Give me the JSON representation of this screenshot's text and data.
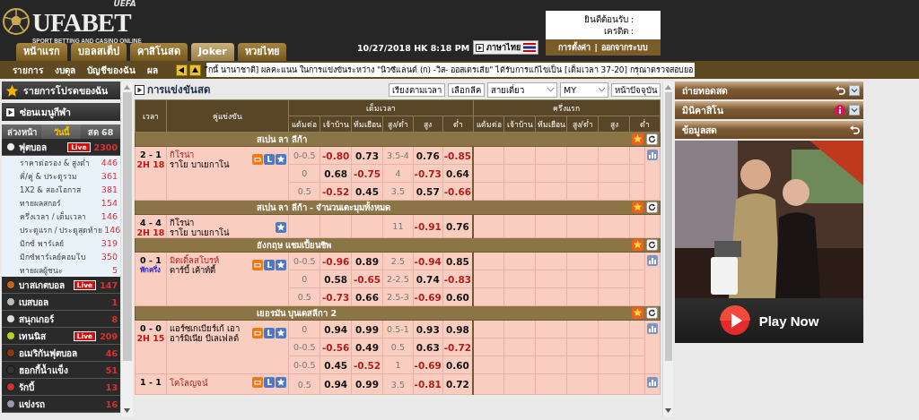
{
  "header": {
    "logo": {
      "badge": "UEFA",
      "text": "UFABET",
      "tagline": "SPORT BETTING AND CASINO ONLINE"
    },
    "tabs": [
      {
        "label": "หน้าแรก",
        "selected": false
      },
      {
        "label": "บอลสเต็ป",
        "selected": false
      },
      {
        "label": "คาสิโนสด",
        "selected": false
      },
      {
        "label": "Joker",
        "selected": true
      },
      {
        "label": "หวยไทย",
        "selected": false
      }
    ],
    "datetime": "10/27/2018 HK 8:18 PM",
    "language": "ภาษาไทย",
    "account": {
      "welcome": "ยินดีต้อนรับ :",
      "credit": "เครดิต :",
      "links": [
        "การตั้งค่า",
        "ออกจากระบบ"
      ],
      "separator": "|"
    }
  },
  "nav": {
    "items": [
      "รายการ",
      "งบดุล",
      "บัญชีของฉัน",
      "ผล"
    ],
    "ticker": "ีกนี้ นานาชาติ] ผลคะแนน ในการแข่งขันระหว่าง \"นิวซีแลนด์ (ก) -วิส- ออสเตรเลีย\" ได้รับการแก้ไขเป็น [เต็มเวลา 37-20] กรุณาตรวจสอบยอ"
  },
  "sidebar": {
    "favorites": "รายการโปรดของฉัน",
    "hide_menu": "ซ่อนเมนูกีฬา",
    "tabs": [
      {
        "label": "ล่วงหน้า",
        "selected": false
      },
      {
        "label": "วันนี้",
        "selected": true
      },
      {
        "label": "สด 68",
        "selected": false
      }
    ],
    "sports": [
      {
        "name": "ฟุตบอล",
        "badge": "Live",
        "count": "2300",
        "children": [
          {
            "name": "ราคาต่อรอง & สูงต่ำ",
            "count": "446"
          },
          {
            "name": "คี่/คู่ & ประตูรวม",
            "count": "361"
          },
          {
            "name": "1X2 & สองโอกาส",
            "count": "381"
          },
          {
            "name": "ทายผลสกอร์",
            "count": "154"
          },
          {
            "name": "ครึ่งเวลา / เต็มเวลา",
            "count": "146"
          },
          {
            "name": "ประตูแรก / ประตูสุดท้าย",
            "count": "146"
          },
          {
            "name": "มิกซ์ พาร์เลย์",
            "count": "319"
          },
          {
            "name": "มิกซ์พาร์เลย์คอมโบ",
            "count": "350"
          },
          {
            "name": "ทายผลผู้ชนะ",
            "count": "5"
          }
        ]
      },
      {
        "name": "บาสเกตบอล",
        "badge": "Live",
        "count": "147"
      },
      {
        "name": "เบสบอล",
        "count": "1"
      },
      {
        "name": "สนุกเกอร์",
        "count": "8"
      },
      {
        "name": "เทนนิส",
        "badge": "Live",
        "count": "209"
      },
      {
        "name": "อเมริกันฟุตบอล",
        "count": "46"
      },
      {
        "name": "ฮอกกี้น้ำแข็ง",
        "count": "51"
      },
      {
        "name": "รักบี้",
        "count": "13"
      },
      {
        "name": "แข่งรถ",
        "count": "16"
      }
    ]
  },
  "main": {
    "title": "การแข่งขันสด",
    "controls": [
      {
        "kind": "button",
        "label": "เรียงตามเวลา"
      },
      {
        "kind": "button",
        "label": "เลือกลีค"
      },
      {
        "kind": "select",
        "value": "สายเดี่ยว"
      },
      {
        "kind": "select",
        "value": "MY"
      },
      {
        "kind": "button",
        "label": "หน้าปัจจุบัน"
      }
    ],
    "columns": {
      "time": "เวลา",
      "match": "คู่แข่งขัน",
      "groups": [
        {
          "label": "เต็มเวลา",
          "columns": [
            "แต้มต่อ",
            "เจ้าบ้าน",
            "ทีมเยือน",
            "สูง/ต่ำ",
            "สูง",
            "ต่ำ"
          ]
        },
        {
          "label": "ครึ่งแรก",
          "columns": [
            "แต้มต่อ",
            "เจ้าบ้าน",
            "ทีมเยือน",
            "สูง/ต่ำ",
            "สูง",
            "ต่ำ"
          ]
        }
      ]
    },
    "leagues": [
      {
        "name": "สเปน ลา ลีก้า",
        "matches": [
          {
            "score": "2 - 1",
            "clock": {
              "text": "2H 18",
              "kind": "running"
            },
            "home": "กิโรน่า",
            "away": "ราโย บาเยกาโน่",
            "home_highlighted": true,
            "stream": true,
            "letter": "L",
            "stats": true,
            "lines": [
              {
                "handicap": "0-0.5",
                "home": "-0.80",
                "away": "0.73",
                "total": "3.5-4",
                "over": "0.76",
                "under": "-0.85"
              },
              {
                "handicap": "0",
                "home": "0.68",
                "away": "-0.75",
                "total": "4",
                "over": "-0.73",
                "under": "0.64"
              },
              {
                "handicap": "0.5",
                "home": "-0.52",
                "away": "0.45",
                "total": "3.5",
                "over": "0.57",
                "under": "-0.66"
              }
            ]
          }
        ]
      },
      {
        "name": "สเปน ลา ลีก้า - จำนวนเตะมุมทั้งหมด",
        "matches": [
          {
            "score": "4 - 4",
            "clock": {
              "text": "2H 18",
              "kind": "running"
            },
            "home": "กิโรน่า",
            "away": "ราโย บาเยกาโน่",
            "home_highlighted": false,
            "stream": false,
            "stats": false,
            "lines": [
              {
                "total": "11",
                "over": "-0.91",
                "under": "0.76"
              }
            ]
          }
        ]
      },
      {
        "name": "อังกฤษ แชมเปี้ยนชิพ",
        "matches": [
          {
            "score": "0 - 1",
            "clock": {
              "text": "พักครึ่ง",
              "kind": "halftime"
            },
            "home": "มิดเดิ้ลสโบรห์",
            "away": "ดาร์บี้ เค้าท์ตี้",
            "home_highlighted": true,
            "stream": true,
            "letter": "L",
            "stats": true,
            "lines": [
              {
                "handicap": "0-0.5",
                "home": "-0.96",
                "away": "0.89",
                "total": "2.5",
                "over": "-0.94",
                "under": "0.85"
              },
              {
                "handicap": "0",
                "home": "0.58",
                "away": "-0.65",
                "total": "2-2.5",
                "over": "0.74",
                "under": "-0.83"
              },
              {
                "handicap": "0.5",
                "home": "-0.73",
                "away": "0.66",
                "total": "2.5-3",
                "over": "-0.69",
                "under": "0.60"
              }
            ]
          }
        ]
      },
      {
        "name": "เยอรมัน บุนเดสลีกา 2",
        "matches": [
          {
            "score": "0 - 0",
            "clock": {
              "text": "2H 15",
              "kind": "running"
            },
            "home": "แอร์ซเกเบียร์เก้ เอา",
            "away": "อาร์มิเนีย บีเลเฟลด์",
            "home_highlighted": false,
            "stream": true,
            "letter": "L",
            "stats": true,
            "lines": [
              {
                "handicap": "0",
                "home": "0.94",
                "away": "0.99",
                "total": "0.5-1",
                "over": "0.93",
                "under": "0.98"
              },
              {
                "handicap": "0-0.5",
                "home": "-0.56",
                "away": "0.49",
                "total": "0.5",
                "over": "0.63",
                "under": "-0.72"
              },
              {
                "handicap": "0-0.5",
                "home": "0.45",
                "away": "-0.52",
                "total": "1",
                "over": "-0.69",
                "under": "0.60"
              }
            ]
          },
          {
            "score": "1 - 1",
            "home": "โคโลญจน์",
            "home_highlighted": true,
            "stream": true,
            "letter": "L",
            "stats": true,
            "lines": [
              {
                "handicap": "0.5",
                "home": "0.94",
                "away": "0.99",
                "total": "3.5",
                "over": "-0.81",
                "under": "0.72"
              }
            ]
          }
        ]
      }
    ]
  },
  "right_panel": {
    "panels": [
      {
        "title": "ถ่ายทอดสด",
        "back": true,
        "info": false,
        "collapse": true
      },
      {
        "title": "มินิคาสิโน",
        "back": false,
        "info": true,
        "collapse": true
      },
      {
        "title": "ข้อมูลสด",
        "back": true,
        "info": false,
        "collapse": false
      }
    ],
    "promo": {
      "kind": "picture",
      "button": "Play Now"
    }
  }
}
